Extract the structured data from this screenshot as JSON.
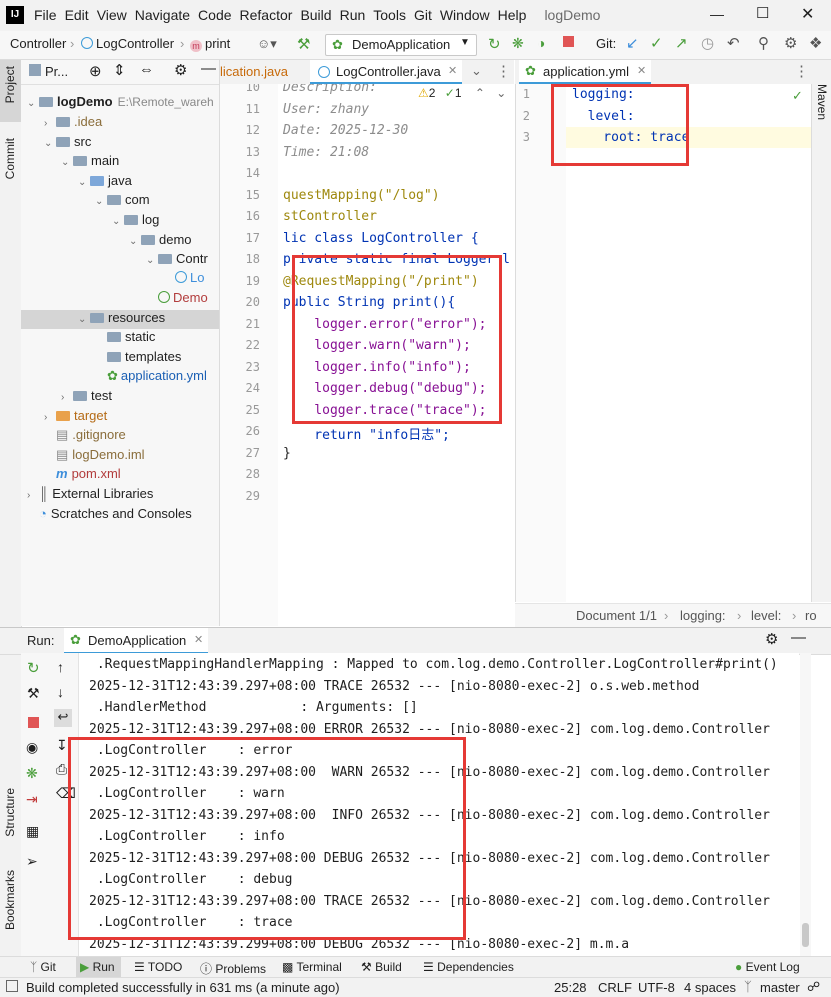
{
  "menu": [
    "File",
    "Edit",
    "View",
    "Navigate",
    "Code",
    "Refactor",
    "Build",
    "Run",
    "Tools",
    "Git",
    "Window",
    "Help"
  ],
  "window_title": "logDemo",
  "breadcrumb": {
    "first": "Controller",
    "second": "LogController",
    "third": "print"
  },
  "run_config": "DemoApplication",
  "git_label": "Git:",
  "left_tabs": {
    "project": "Project",
    "commit": "Commit",
    "structure": "Structure",
    "bookmarks": "Bookmarks"
  },
  "right_tabs": {
    "maven": "Maven"
  },
  "project_panel": {
    "title": "Pr...",
    "tree": [
      {
        "label": "logDemo",
        "extra": "E:\\Remote_wareh",
        "depth": 0,
        "kind": "module"
      },
      {
        "label": ".idea",
        "depth": 1,
        "kind": "folder"
      },
      {
        "label": "src",
        "depth": 1,
        "kind": "folder"
      },
      {
        "label": "main",
        "depth": 2,
        "kind": "folder"
      },
      {
        "label": "java",
        "depth": 3,
        "kind": "folder-blue"
      },
      {
        "label": "com",
        "depth": 4,
        "kind": "folder"
      },
      {
        "label": "log",
        "depth": 5,
        "kind": "folder"
      },
      {
        "label": "demo",
        "depth": 6,
        "kind": "folder"
      },
      {
        "label": "Contr",
        "depth": 7,
        "kind": "folder"
      },
      {
        "label": "Lo",
        "depth": 8,
        "kind": "class"
      },
      {
        "label": "Demo",
        "depth": 7,
        "kind": "springclass"
      },
      {
        "label": "resources",
        "depth": 3,
        "kind": "folder"
      },
      {
        "label": "static",
        "depth": 4,
        "kind": "folder"
      },
      {
        "label": "templates",
        "depth": 4,
        "kind": "folder"
      },
      {
        "label": "application.yml",
        "depth": 4,
        "kind": "yml"
      },
      {
        "label": "test",
        "depth": 2,
        "kind": "folder"
      },
      {
        "label": "target",
        "depth": 1,
        "kind": "folder-orange"
      },
      {
        "label": ".gitignore",
        "depth": 1,
        "kind": "file"
      },
      {
        "label": "logDemo.iml",
        "depth": 1,
        "kind": "file"
      },
      {
        "label": "pom.xml",
        "depth": 1,
        "kind": "maven"
      },
      {
        "label": "External Libraries",
        "depth": 0,
        "kind": "lib"
      },
      {
        "label": "Scratches and Consoles",
        "depth": 0,
        "kind": "scratch"
      }
    ]
  },
  "editor_tabs": [
    {
      "label": "lication.java"
    },
    {
      "label": "LogController.java",
      "active": true
    },
    {
      "label": "application.yml"
    }
  ],
  "editor_warnings": {
    "warn": "2",
    "ok": "1"
  },
  "editor": {
    "lines": [
      {
        "n": "10",
        "text": "Description:"
      },
      {
        "n": "11",
        "text": "User: zhany"
      },
      {
        "n": "12",
        "text": "Date: 2025-12-30"
      },
      {
        "n": "13",
        "text": "Time: 21:08"
      },
      {
        "n": "14",
        "text": ""
      },
      {
        "n": "15",
        "text": "questMapping(\"/log\")"
      },
      {
        "n": "16",
        "text": "stController"
      },
      {
        "n": "17",
        "text": "lic class LogController {"
      },
      {
        "n": "18",
        "text": "private static final Logger l"
      },
      {
        "n": "19",
        "text": "@RequestMapping(\"/print\")"
      },
      {
        "n": "20",
        "text": "public String print(){"
      },
      {
        "n": "21",
        "text": "    logger.error(\"error\");"
      },
      {
        "n": "22",
        "text": "    logger.warn(\"warn\");"
      },
      {
        "n": "23",
        "text": "    logger.info(\"info\");"
      },
      {
        "n": "24",
        "text": "    logger.debug(\"debug\");"
      },
      {
        "n": "25",
        "text": "    logger.trace(\"trace\");"
      },
      {
        "n": "26",
        "text": "    return \"info日志\";"
      },
      {
        "n": "27",
        "text": "}"
      },
      {
        "n": "28",
        "text": ""
      },
      {
        "n": "29",
        "text": ""
      }
    ]
  },
  "yml": {
    "lines": [
      {
        "n": "1",
        "text": "logging:"
      },
      {
        "n": "2",
        "text": "  level:"
      },
      {
        "n": "3",
        "text": "    root: trace"
      }
    ],
    "status": {
      "doc": "Document 1/1",
      "p1": "logging:",
      "p2": "level:",
      "p3": "ro"
    }
  },
  "run_panel": {
    "label": "Run:",
    "tab": "DemoApplication",
    "console_lines": [
      " .RequestMappingHandlerMapping : Mapped to com.log.demo.Controller.LogController#print()",
      "2025-12-31T12:43:39.297+08:00 TRACE 26532 --- [nio-8080-exec-2] o.s.web.method",
      " .HandlerMethod            : Arguments: []",
      "2025-12-31T12:43:39.297+08:00 ERROR 26532 --- [nio-8080-exec-2] com.log.demo.Controller",
      " .LogController    : error",
      "2025-12-31T12:43:39.297+08:00  WARN 26532 --- [nio-8080-exec-2] com.log.demo.Controller",
      " .LogController    : warn",
      "2025-12-31T12:43:39.297+08:00  INFO 26532 --- [nio-8080-exec-2] com.log.demo.Controller",
      " .LogController    : info",
      "2025-12-31T12:43:39.297+08:00 DEBUG 26532 --- [nio-8080-exec-2] com.log.demo.Controller",
      " .LogController    : debug",
      "2025-12-31T12:43:39.297+08:00 TRACE 26532 --- [nio-8080-exec-2] com.log.demo.Controller",
      " .LogController    : trace",
      "2025-12-31T12:43:39.299+08:00 DEBUG 26532 --- [nio-8080-exec-2] m.m.a"
    ]
  },
  "bottom_tabs": [
    "Git",
    "Run",
    "TODO",
    "Problems",
    "Terminal",
    "Build",
    "Dependencies",
    "Event Log"
  ],
  "status": {
    "message": "Build completed successfully in 631 ms (a minute ago)",
    "position": "25:28",
    "line_sep": "CRLF",
    "encoding": "UTF-8",
    "indent": "4 spaces",
    "branch": "master"
  },
  "colors": {
    "accent": "#3d9bd8",
    "red_box": "#e53935",
    "keyword": "#0033b3",
    "string": "#067d17",
    "annotation": "#9e880d",
    "field": "#871094"
  }
}
